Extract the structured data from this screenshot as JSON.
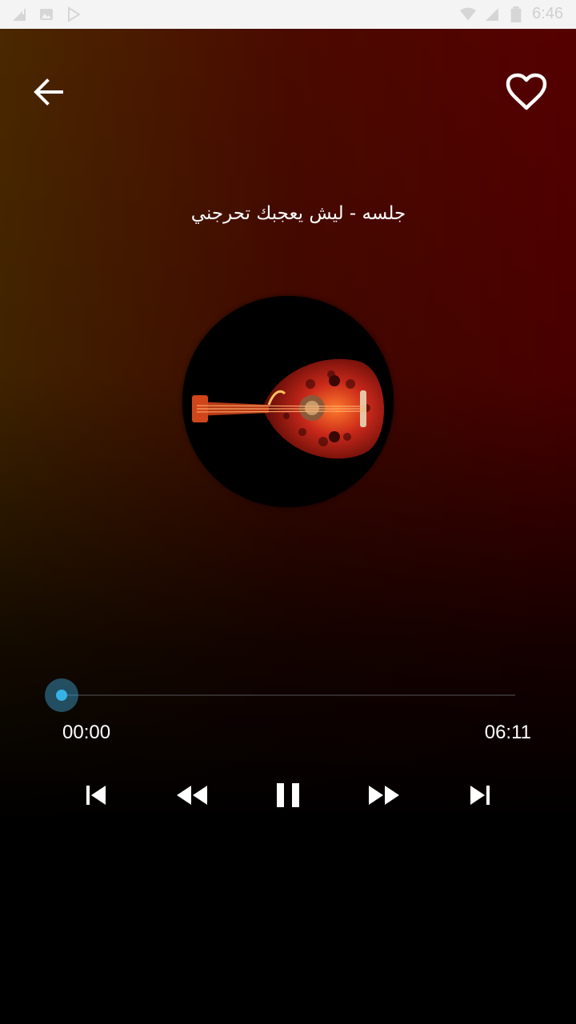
{
  "status_bar": {
    "time": "6:46",
    "left_icons": [
      "signal-muted-icon",
      "image-icon",
      "play-store-icon"
    ],
    "right_icons": [
      "wifi-icon",
      "cell-signal-icon",
      "battery-icon"
    ]
  },
  "header": {
    "back_icon": "arrow-left-icon",
    "favorite_icon": "heart-outline-icon"
  },
  "track": {
    "title": "جلسه - ليش يعجبك تحرجني",
    "artwork": "oud-instrument-artwork"
  },
  "playback": {
    "current_time": "00:00",
    "total_time": "06:11",
    "progress": 0.0,
    "accent_color": "#36b2e6"
  },
  "controls": {
    "icons": [
      "skip-previous-icon",
      "rewind-icon",
      "pause-icon",
      "fast-forward-icon",
      "skip-next-icon"
    ]
  },
  "colors": {
    "gradient_left": "#4a2800",
    "gradient_right": "#550000",
    "bottom": "#000000"
  }
}
